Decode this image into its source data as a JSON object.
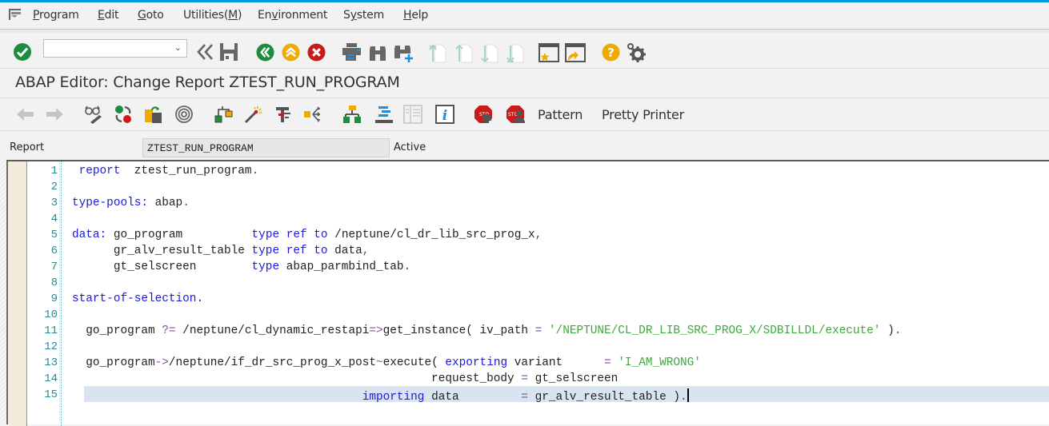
{
  "menubar": {
    "items": [
      {
        "label": "Program",
        "mnemonic": "P"
      },
      {
        "label": "Edit",
        "mnemonic": "E"
      },
      {
        "label": "Goto",
        "mnemonic": "G"
      },
      {
        "label": "Utilities(M)",
        "mnemonic": "M"
      },
      {
        "label": "Environment",
        "mnemonic": "v"
      },
      {
        "label": "System",
        "mnemonic": "y"
      },
      {
        "label": "Help",
        "mnemonic": "H"
      }
    ]
  },
  "toolbar1": {
    "command_field": {
      "value": "",
      "placeholder": ""
    },
    "icons": [
      "check-icon",
      "command-dropdown",
      "back-double-icon",
      "save-icon",
      "back-icon",
      "exit-icon",
      "cancel-icon",
      "print-icon",
      "find-icon",
      "find-next-icon",
      "first-page-icon",
      "previous-page-icon",
      "next-page-icon",
      "last-page-icon",
      "new-session-icon",
      "shortcut-icon",
      "help-icon",
      "settings-icon"
    ]
  },
  "title": "ABAP Editor: Change Report ZTEST_RUN_PROGRAM",
  "toolbar2": {
    "icons": [
      "back-arrow-icon",
      "forward-arrow-icon",
      "display-change-icon",
      "active-inactive-icon",
      "other-object-icon",
      "check-syntax-icon",
      "activate-icon",
      "test-icon",
      "where-used-icon",
      "navigate-icon",
      "object-list-icon",
      "display-object-list-icon",
      "split-screen-icon",
      "info-icon",
      "set-breakpoint-icon",
      "set-session-breakpoint-icon"
    ],
    "pattern_label": "Pattern",
    "pretty_printer_label": "Pretty Printer"
  },
  "report_field": {
    "label": "Report",
    "value": "ZTEST_RUN_PROGRAM",
    "status": "Active"
  },
  "editor": {
    "line_numbers": [
      "1",
      "2",
      "3",
      "4",
      "5",
      "6",
      "7",
      "8",
      "9",
      "10",
      "11",
      "12",
      "13",
      "14",
      "15"
    ],
    "current_line": 15,
    "lines": [
      [
        {
          "t": " "
        },
        {
          "t": "report",
          "c": "kw"
        },
        {
          "t": "  ztest_run_program"
        },
        {
          "t": ".",
          "c": "op"
        }
      ],
      [],
      [
        {
          "t": "type-pools:",
          "c": "kw"
        },
        {
          "t": " abap"
        },
        {
          "t": ".",
          "c": "op"
        }
      ],
      [],
      [
        {
          "t": "data:",
          "c": "kw"
        },
        {
          "t": " go_program          "
        },
        {
          "t": "type ref to",
          "c": "kw"
        },
        {
          "t": " /neptune/cl_dr_lib_src_prog_x"
        },
        {
          "t": ",",
          "c": "op"
        }
      ],
      [
        {
          "t": "      gr_alv_result_table "
        },
        {
          "t": "type ref to",
          "c": "kw"
        },
        {
          "t": " data"
        },
        {
          "t": ",",
          "c": "op"
        }
      ],
      [
        {
          "t": "      gt_selscreen        "
        },
        {
          "t": "type",
          "c": "kw"
        },
        {
          "t": " abap_parmbind_tab"
        },
        {
          "t": ".",
          "c": "op"
        }
      ],
      [],
      [
        {
          "t": "start-of-selection.",
          "c": "kw"
        }
      ],
      [],
      [
        {
          "t": "  go_program "
        },
        {
          "t": "?=",
          "c": "ops"
        },
        {
          "t": " /neptune/cl_dynamic_restapi"
        },
        {
          "t": "=>",
          "c": "ops"
        },
        {
          "t": "get_instance( iv_path "
        },
        {
          "t": "=",
          "c": "ops"
        },
        {
          "t": " "
        },
        {
          "t": "'/NEPTUNE/CL_DR_LIB_SRC_PROG_X/SDBILLDL/execute'",
          "c": "str"
        },
        {
          "t": " )"
        },
        {
          "t": ".",
          "c": "op"
        }
      ],
      [],
      [
        {
          "t": "  go_program"
        },
        {
          "t": "->",
          "c": "ops"
        },
        {
          "t": "/neptune/if_dr_src_prog_x_post"
        },
        {
          "t": "~",
          "c": "ops"
        },
        {
          "t": "execute( "
        },
        {
          "t": "exporting",
          "c": "kw"
        },
        {
          "t": " variant      "
        },
        {
          "t": "=",
          "c": "ops"
        },
        {
          "t": " "
        },
        {
          "t": "'I_AM_WRONG'",
          "c": "str"
        }
      ],
      [
        {
          "t": "                                                    request_body "
        },
        {
          "t": "=",
          "c": "ops"
        },
        {
          "t": " gt_selscreen"
        }
      ],
      [
        {
          "t": "                                          "
        },
        {
          "t": "importing",
          "c": "kw"
        },
        {
          "t": " data         "
        },
        {
          "t": "=",
          "c": "ops"
        },
        {
          "t": " gr_alv_result_table )"
        },
        {
          "t": ".",
          "c": "op"
        }
      ]
    ]
  }
}
